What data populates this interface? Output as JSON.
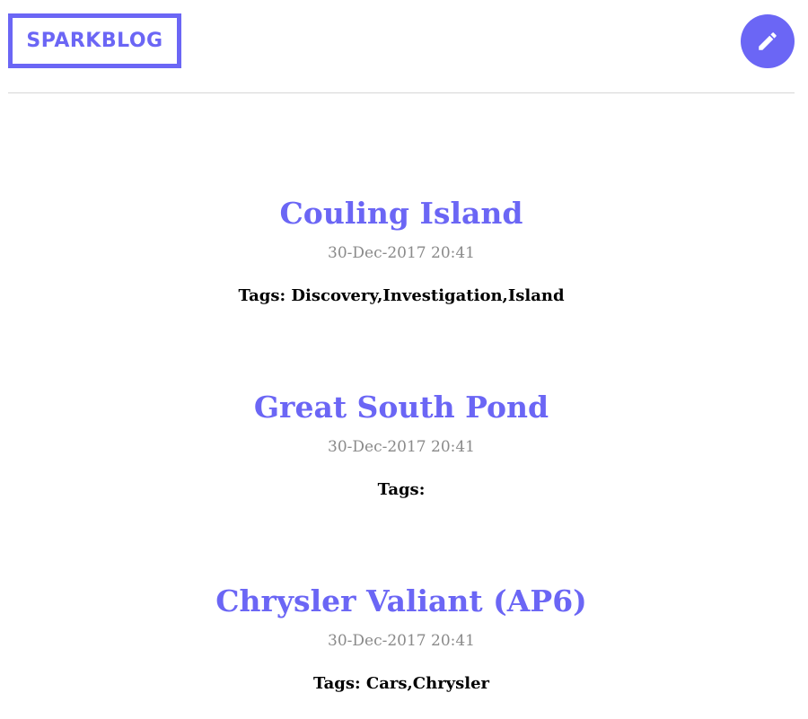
{
  "header": {
    "logo_text": "SPARKBLOG",
    "write_icon": "pencil-edit-icon"
  },
  "colors": {
    "accent": "#6b66f5",
    "date": "#8a8a8a",
    "divider": "#d6d6d6"
  },
  "posts": [
    {
      "title": "Couling Island",
      "date": "30-Dec-2017 20:41",
      "tags": "Tags: Discovery,Investigation,Island"
    },
    {
      "title": "Great South Pond",
      "date": "30-Dec-2017 20:41",
      "tags": "Tags:"
    },
    {
      "title": "Chrysler Valiant (AP6)",
      "date": "30-Dec-2017 20:41",
      "tags": "Tags: Cars,Chrysler"
    }
  ]
}
